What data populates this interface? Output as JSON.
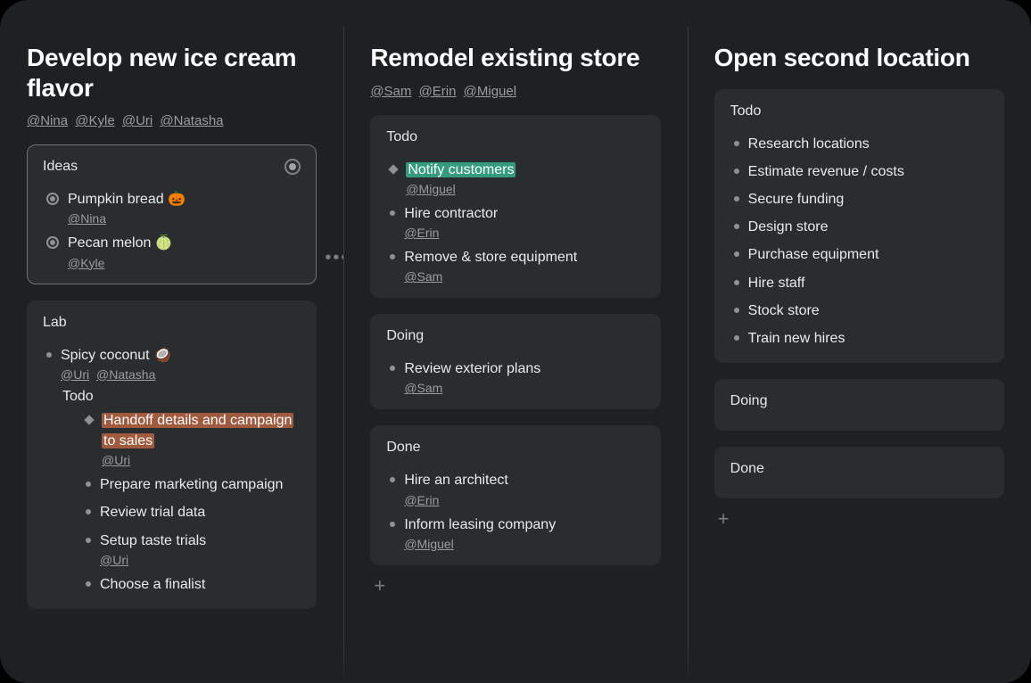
{
  "columns": [
    {
      "title": "Develop new ice cream flavor",
      "assignees": [
        "@Nina",
        "@Kyle",
        "@Uri",
        "@Natasha"
      ],
      "cards": [
        {
          "name": "ideas-card",
          "title": "Ideas",
          "selected": true,
          "headerIcon": "radio",
          "items": [
            {
              "bullet": "radio",
              "text": "Pumpkin bread 🎃",
              "mentions": [
                "@Nina"
              ]
            },
            {
              "bullet": "radio",
              "text": "Pecan melon 🍈",
              "mentions": [
                "@Kyle"
              ]
            }
          ]
        },
        {
          "name": "lab-card",
          "title": "Lab",
          "items": [
            {
              "bullet": "dot",
              "text": "Spicy coconut 🥥",
              "mentions": [
                "@Uri",
                "@Natasha"
              ],
              "children": {
                "title": "Todo",
                "items": [
                  {
                    "bullet": "diamond",
                    "highlight": "orange",
                    "text": "Handoff details and campaign to sales",
                    "mentions": [
                      "@Uri"
                    ]
                  },
                  {
                    "bullet": "dot",
                    "text": "Prepare marketing campaign"
                  },
                  {
                    "bullet": "dot",
                    "text": "Review trial data"
                  },
                  {
                    "bullet": "dot",
                    "text": "Setup taste trials",
                    "mentions": [
                      "@Uri"
                    ]
                  },
                  {
                    "bullet": "dot",
                    "text": "Choose a finalist"
                  }
                ]
              }
            }
          ]
        }
      ],
      "showEllipsis": true
    },
    {
      "title": "Remodel existing store",
      "assignees": [
        "@Sam",
        "@Erin",
        "@Miguel"
      ],
      "cards": [
        {
          "name": "todo-card",
          "title": "Todo",
          "items": [
            {
              "bullet": "diamond",
              "highlight": "green",
              "text": "Notify customers",
              "mentions": [
                "@Miguel"
              ]
            },
            {
              "bullet": "dot",
              "text": "Hire contractor",
              "mentions": [
                "@Erin"
              ]
            },
            {
              "bullet": "dot",
              "text": "Remove & store equipment",
              "mentions": [
                "@Sam"
              ]
            }
          ]
        },
        {
          "name": "doing-card",
          "title": "Doing",
          "items": [
            {
              "bullet": "dot",
              "text": "Review exterior plans",
              "mentions": [
                "@Sam"
              ]
            }
          ]
        },
        {
          "name": "done-card",
          "title": "Done",
          "items": [
            {
              "bullet": "dot",
              "text": "Hire an architect",
              "mentions": [
                "@Erin"
              ]
            },
            {
              "bullet": "dot",
              "text": "Inform leasing company",
              "mentions": [
                "@Miguel"
              ]
            }
          ]
        }
      ],
      "showPlus": true
    },
    {
      "title": "Open second location",
      "assignees": [],
      "cards": [
        {
          "name": "todo-card",
          "title": "Todo",
          "items": [
            {
              "bullet": "dot",
              "text": "Research locations"
            },
            {
              "bullet": "dot",
              "text": "Estimate revenue / costs"
            },
            {
              "bullet": "dot",
              "text": "Secure funding"
            },
            {
              "bullet": "dot",
              "text": "Design store"
            },
            {
              "bullet": "dot",
              "text": "Purchase equipment"
            },
            {
              "bullet": "dot",
              "text": "Hire staff"
            },
            {
              "bullet": "dot",
              "text": "Stock store"
            },
            {
              "bullet": "dot",
              "text": "Train new hires"
            }
          ]
        },
        {
          "name": "doing-card",
          "title": "Doing",
          "items": []
        },
        {
          "name": "done-card",
          "title": "Done",
          "items": []
        }
      ],
      "showPlus": true
    }
  ],
  "glyphs": {
    "plus": "+",
    "ellipsis": "•••"
  }
}
